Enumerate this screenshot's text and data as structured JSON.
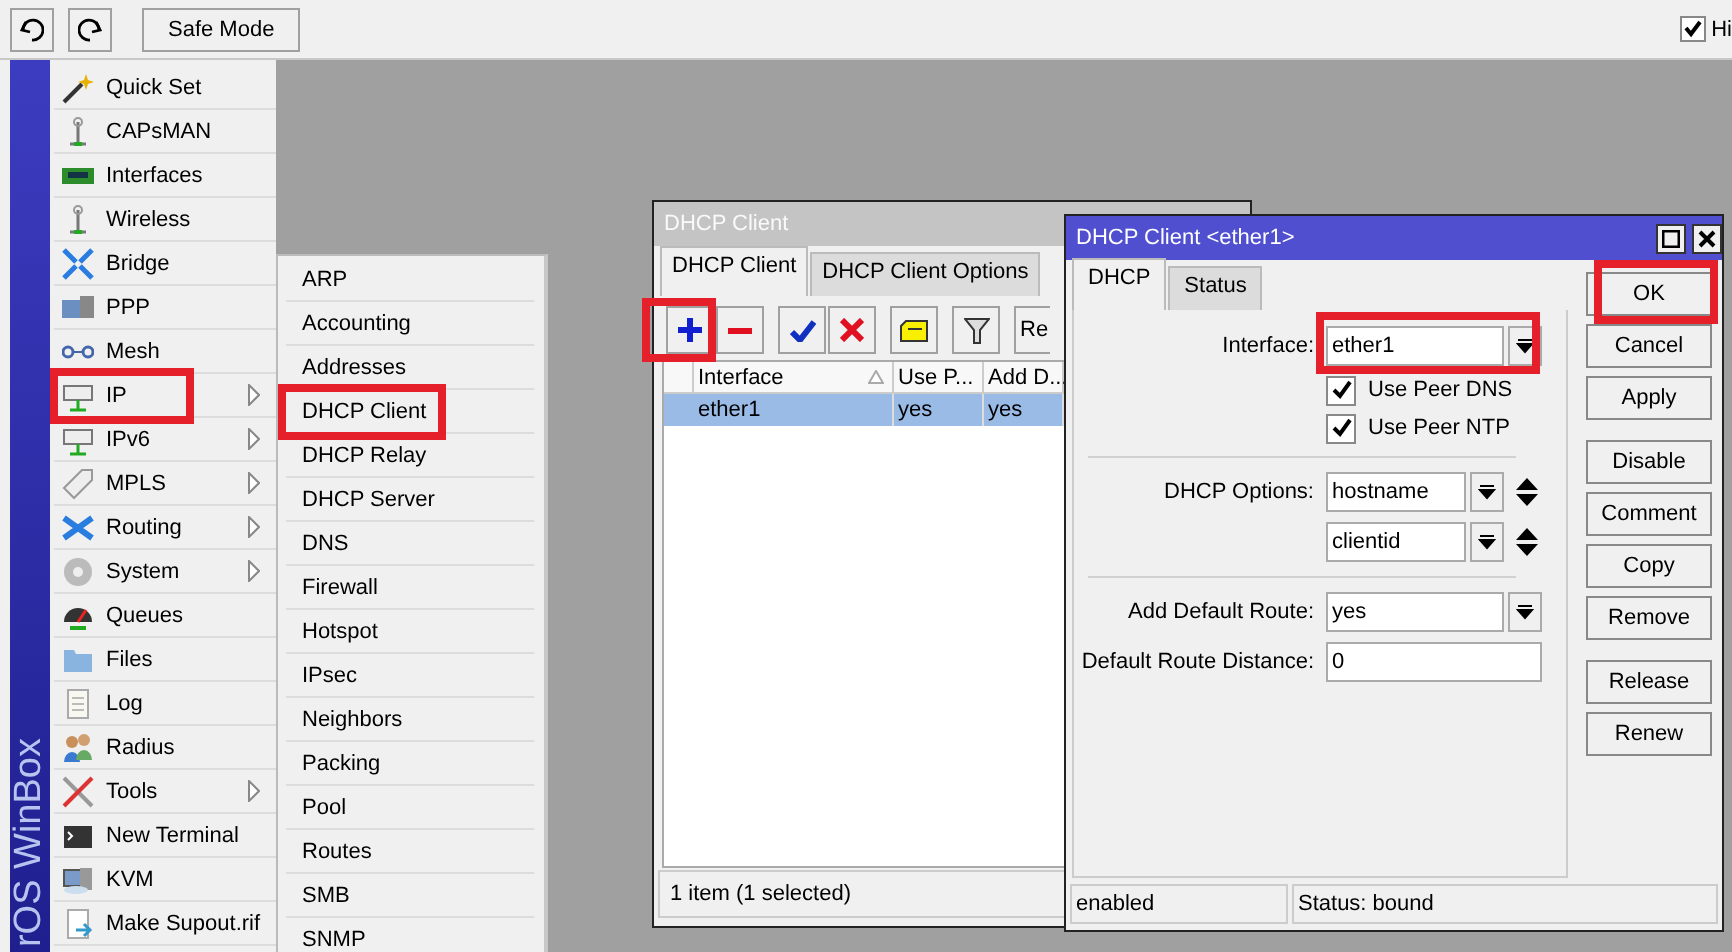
{
  "toolbar": {
    "buttons": [
      {
        "kind": "undo"
      },
      {
        "kind": "redo"
      }
    ],
    "safe_mode": "Safe Mode",
    "hide_passwords": {
      "label": "Hi",
      "checked": true
    }
  },
  "brand": "rOS WinBox",
  "menu": [
    {
      "label": "Quick Set",
      "submenu": false,
      "highlighted": false
    },
    {
      "label": "CAPsMAN",
      "submenu": false,
      "highlighted": false
    },
    {
      "label": "Interfaces",
      "submenu": false,
      "highlighted": false
    },
    {
      "label": "Wireless",
      "submenu": false,
      "highlighted": false
    },
    {
      "label": "Bridge",
      "submenu": false,
      "highlighted": false
    },
    {
      "label": "PPP",
      "submenu": false,
      "highlighted": false
    },
    {
      "label": "Mesh",
      "submenu": false,
      "highlighted": false
    },
    {
      "label": "IP",
      "submenu": true,
      "highlighted": true
    },
    {
      "label": "IPv6",
      "submenu": true,
      "highlighted": false
    },
    {
      "label": "MPLS",
      "submenu": true,
      "highlighted": false
    },
    {
      "label": "Routing",
      "submenu": true,
      "highlighted": false
    },
    {
      "label": "System",
      "submenu": true,
      "highlighted": false
    },
    {
      "label": "Queues",
      "submenu": false,
      "highlighted": false
    },
    {
      "label": "Files",
      "submenu": false,
      "highlighted": false
    },
    {
      "label": "Log",
      "submenu": false,
      "highlighted": false
    },
    {
      "label": "Radius",
      "submenu": false,
      "highlighted": false
    },
    {
      "label": "Tools",
      "submenu": true,
      "highlighted": false
    },
    {
      "label": "New Terminal",
      "submenu": false,
      "highlighted": false
    },
    {
      "label": "KVM",
      "submenu": false,
      "highlighted": false
    },
    {
      "label": "Make Supout.rif",
      "submenu": false,
      "highlighted": false
    }
  ],
  "submenu": [
    {
      "label": "ARP",
      "highlighted": false
    },
    {
      "label": "Accounting",
      "highlighted": false
    },
    {
      "label": "Addresses",
      "highlighted": false
    },
    {
      "label": "DHCP Client",
      "highlighted": true
    },
    {
      "label": "DHCP Relay",
      "highlighted": false
    },
    {
      "label": "DHCP Server",
      "highlighted": false
    },
    {
      "label": "DNS",
      "highlighted": false
    },
    {
      "label": "Firewall",
      "highlighted": false
    },
    {
      "label": "Hotspot",
      "highlighted": false
    },
    {
      "label": "IPsec",
      "highlighted": false
    },
    {
      "label": "Neighbors",
      "highlighted": false
    },
    {
      "label": "Packing",
      "highlighted": false
    },
    {
      "label": "Pool",
      "highlighted": false
    },
    {
      "label": "Routes",
      "highlighted": false
    },
    {
      "label": "SMB",
      "highlighted": false
    },
    {
      "label": "SNMP",
      "highlighted": false
    }
  ],
  "list_window": {
    "title": "DHCP Client",
    "tabs": [
      {
        "label": "DHCP Client",
        "selected": true
      },
      {
        "label": "DHCP Client Options",
        "selected": false
      }
    ],
    "toolbar": [
      {
        "kind": "add",
        "highlighted": true
      },
      {
        "kind": "remove",
        "highlighted": false
      },
      {
        "kind": "enable",
        "highlighted": false
      },
      {
        "kind": "disable",
        "highlighted": false
      },
      {
        "kind": "comment",
        "highlighted": false
      },
      {
        "kind": "filter",
        "highlighted": false
      },
      {
        "kind": "text",
        "label": "Re",
        "highlighted": false
      }
    ],
    "columns": [
      {
        "label": "Interface",
        "sorted": true
      },
      {
        "label": "Use P...",
        "sorted": false
      },
      {
        "label": "Add D...",
        "sorted": false
      }
    ],
    "rows": [
      {
        "cells": [
          "ether1",
          "yes",
          "yes"
        ],
        "selected": true
      }
    ],
    "status": "1 item (1 selected)"
  },
  "dialog": {
    "title": "DHCP Client <ether1>",
    "tabs": [
      {
        "label": "DHCP",
        "selected": true
      },
      {
        "label": "Status",
        "selected": false
      }
    ],
    "fields": [
      {
        "kind": "select",
        "label": "Interface:",
        "value": "ether1",
        "highlighted": true
      },
      {
        "kind": "checkbox",
        "label": "Use Peer DNS",
        "checked": true
      },
      {
        "kind": "checkbox",
        "label": "Use Peer NTP",
        "checked": true
      },
      {
        "kind": "divider"
      },
      {
        "kind": "multi",
        "label": "DHCP Options:",
        "values": [
          "hostname",
          "clientid"
        ]
      },
      {
        "kind": "divider"
      },
      {
        "kind": "select",
        "label": "Add Default Route:",
        "value": "yes",
        "highlighted": false
      },
      {
        "kind": "text",
        "label": "Default Route Distance:",
        "value": "0"
      }
    ],
    "button_groups": [
      [
        {
          "label": "OK",
          "highlighted": true
        },
        {
          "label": "Cancel",
          "highlighted": false
        },
        {
          "label": "Apply",
          "highlighted": false
        }
      ],
      [
        {
          "label": "Disable",
          "highlighted": false
        },
        {
          "label": "Comment",
          "highlighted": false
        },
        {
          "label": "Copy",
          "highlighted": false
        },
        {
          "label": "Remove",
          "highlighted": false
        }
      ],
      [
        {
          "label": "Release",
          "highlighted": false
        },
        {
          "label": "Renew",
          "highlighted": false
        }
      ]
    ],
    "status": [
      "enabled",
      "Status: bound"
    ]
  }
}
